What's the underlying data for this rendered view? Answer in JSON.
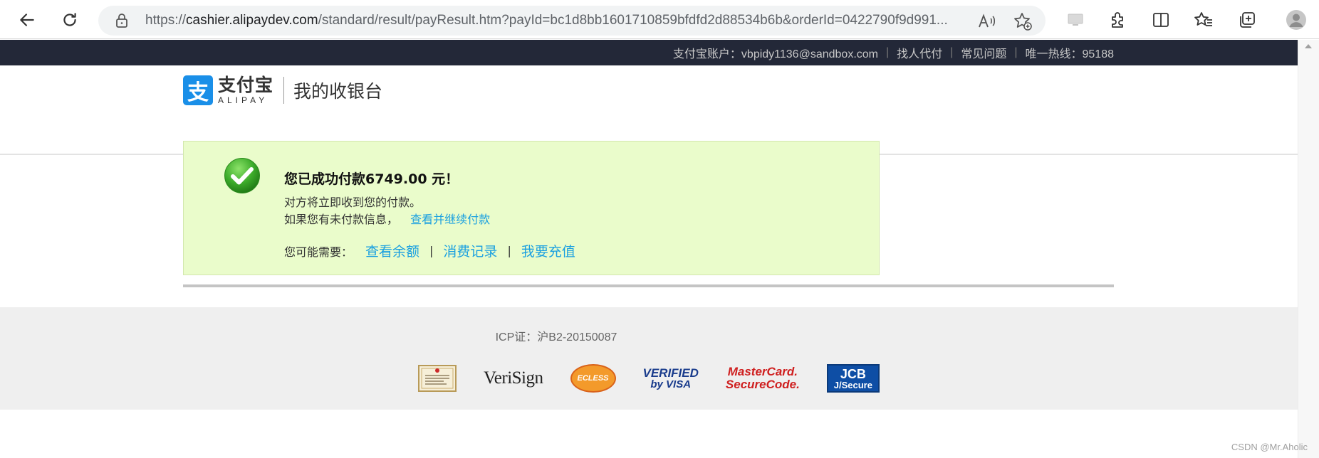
{
  "browser": {
    "url_prefix": "https://",
    "url_host": "cashier.alipaydev.com",
    "url_path": "/standard/result/payResult.htm?payId=bc1d8bb1601710859bfdfd2d88534b6b&orderId=0422790f9d991..."
  },
  "topbar": {
    "account_label": "支付宝账户：vbpidy1136@sandbox.com",
    "find_proxy": "找人代付",
    "faq": "常见问题",
    "hotline": "唯一热线：95188"
  },
  "header": {
    "logo_cn": "支付宝",
    "logo_en": "ALIPAY",
    "logo_glyph": "支",
    "title": "我的收银台"
  },
  "result": {
    "title": "您已成功付款6749.00 元！",
    "line1": "对方将立即收到您的付款。",
    "line2_prefix": "如果您有未付款信息，",
    "line2_link": "查看并继续付款",
    "maybe_label": "您可能需要：",
    "link_balance": "查看余额",
    "link_records": "消费记录",
    "link_recharge": "我要充值",
    "separator": "|"
  },
  "footer": {
    "icp": "ICP证：沪B2-20150087",
    "badges": {
      "verisign": "VeriSign",
      "ecless": "ECLESS",
      "visa_top": "VERIFIED",
      "visa_bottom": "by VISA",
      "mc_top": "MasterCard.",
      "mc_bottom": "SecureCode.",
      "jcb_top": "JCB",
      "jcb_bottom": "J/Secure"
    }
  },
  "watermark": "CSDN @Mr.Aholic",
  "colors": {
    "topbar_bg": "#232838",
    "link": "#1aa0e0",
    "result_bg": "#eafccb",
    "alipay_blue": "#1a8fe8",
    "success_green": "#3cab2a"
  }
}
